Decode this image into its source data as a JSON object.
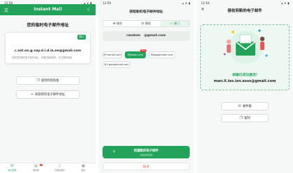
{
  "panel1": {
    "status_time": "12:59",
    "status_icons": "▴ ▾ ▮",
    "app_title": "Instant Mail",
    "translate_icon": "translate-icon",
    "moon_icon": "moon-icon",
    "heading": "您的临时电子邮件地址",
    "tag": "默认",
    "email": "c.ast.on.g.vay.d.i.d.ia.ne@gmail.com",
    "hint": "这是您的临时电子邮件地址，可随时接收邮件。在过期前使用。",
    "copy_button": "复制到剪贴板",
    "new_button": "获取新的电子邮件地址",
    "nav": [
      {
        "label": "电子邮件",
        "icon": "mail-icon",
        "active": true
      },
      {
        "label": "收件箱",
        "icon": "inbox-icon",
        "badge": "2",
        "active": false
      },
      {
        "label": "已保存邮件",
        "icon": "bookmark-icon",
        "active": false
      },
      {
        "label": "更多",
        "icon": "grid-icon",
        "active": false
      }
    ]
  },
  "panel2": {
    "status_time": "12:59",
    "status_icons": "▴ ▾ ▮",
    "title": "获取新的电子邮件地址",
    "tabs": [
      {
        "label": "域名",
        "icon": "globe-icon",
        "active": false
      },
      {
        "label": "随机",
        "icon": "shuffle-icon",
        "active": false
      },
      {
        "label": "热门",
        "icon": "star-icon",
        "active": true
      }
    ],
    "compose_prefix": "random",
    "compose_domain": "@gmail.com",
    "domains": [
      {
        "label": "@+gmail.com",
        "selected": false
      },
      {
        "label": "@gmail.com",
        "selected": true,
        "badge": "New"
      },
      {
        "label": "@googlemail.com",
        "selected": false
      },
      {
        "label": "@+googlemail.com",
        "selected": false
      }
    ],
    "create_label": "创建新的电子邮件",
    "create_sub": "点击此处创建",
    "cancel_label": "取消"
  },
  "panel3": {
    "status_time": "12:59",
    "status_icons": "▴ ▾ ▮",
    "title": "接收到新的电子邮件",
    "success": "邮箱已成功激活!",
    "email": "man.li.ies.izn.esss@gmail.com",
    "inbox_button": "收件箱",
    "copy_button": "复制"
  },
  "colors": {
    "accent": "#23a35a",
    "danger": "#e53935",
    "background": "#f6f8f7"
  }
}
